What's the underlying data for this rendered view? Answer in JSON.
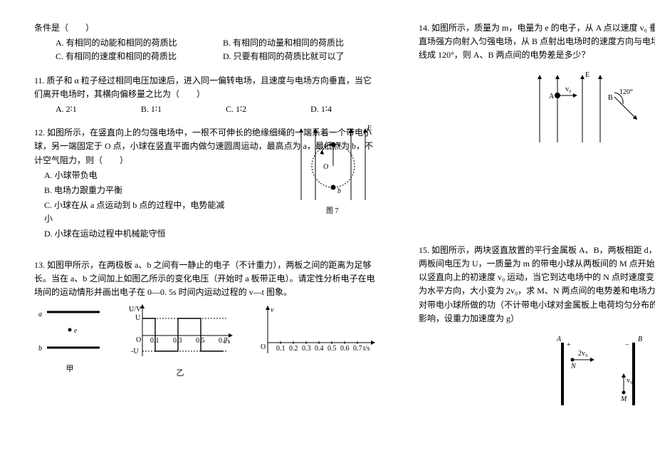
{
  "left": {
    "q10": {
      "stem": "条件是（　　）",
      "optA": "A. 有相同的动能和相同的荷质比",
      "optB": "B. 有相同的动量和相同的荷质比",
      "optC": "C. 有相同的速度和相同的荷质比",
      "optD": "D. 只要有相同的荷质比就可以了"
    },
    "q11": {
      "stem": "11. 质子和 α 粒子经过相同电压加速后，进入同一偏转电场，且速度与电场方向垂直，当它们离开电场时，其横向偏移量之比为（　　）",
      "optA": "A. 2∶1",
      "optB": "B. 1∶1",
      "optC": "C. 1∶2",
      "optD": "D. 1∶4"
    },
    "q12": {
      "stem": "12. 如图所示，在竖直向上的匀强电场中，一根不可伸长的绝缘细绳的一端系着一个带电小球，另一端固定于 O 点，小球在竖直平面内做匀速圆周运动，最高点为 a，最低点为 b，不计空气阻力，则（　　）",
      "optA": "A. 小球带负电",
      "optB": "B. 电场力跟重力平衡",
      "optC": "C. 小球在从 a 点运动到 b 点的过程中，电势能减小",
      "optD": "D. 小球在运动过程中机械能守恒",
      "figCap": "图 7",
      "E": "E",
      "a": "a",
      "b": "b",
      "O": "O"
    },
    "q13": {
      "stem": "13. 如图甲所示，在两极板 a、b 之间有一静止的电子（不计重力），两板之间的距离为足够长。当在 a、b 之间加上如图乙所示的变化电压（开始时 a 板带正电）。请定性分析电子在电场间的运动情形并画出电子在 0—0. 5s 时间内运动过程的 v—t 图象。",
      "a": "a",
      "b": "b",
      "e": "e",
      "cap1": "甲",
      "cap2": "乙",
      "yU": "U/V",
      "U": "U",
      "mU": "-U",
      "t": "t/s",
      "O": "O",
      "v": "v",
      "tt": "t/s",
      "xt": [
        "0.1",
        "0.2",
        "0.3",
        "0.4",
        "0.5",
        "0.6",
        "0.7"
      ],
      "xt2": [
        "0.1",
        "0.3",
        "0.5",
        "0.7"
      ]
    }
  },
  "right": {
    "q14": {
      "stem": "14. 如图所示，质量为 m，电量为 e 的电子，从 A 点以速度 v₀ 垂直场强方向射入匀强电场，从 B 点射出电场时的速度方向与电场线成 120°，则 A、B 两点间的电势差是多少？",
      "E": "E",
      "A": "A",
      "B": "B",
      "v0": "v₀",
      "ang": "120°"
    },
    "q15": {
      "stem": "15. 如图所示，两块竖直放置的平行金属板 A、B，两板相距 d，两板间电压为 U，一质量为 m 的带电小球从两板间的 M 点开始以竖直向上的初速度 v₀ 运动，当它到达电场中的 N 点时速度变为水平方向，大小变为 2v₀，求 M、N 两点间的电势差和电场力对带电小球所做的功（不计带电小球对金属板上电荷均匀分布的影响，设重力加速度为 g）",
      "A": "A",
      "B": "B",
      "M": "M",
      "N": "N",
      "plus": "+",
      "minus": "−",
      "v0": "v₀",
      "v02": "2v₀"
    }
  }
}
